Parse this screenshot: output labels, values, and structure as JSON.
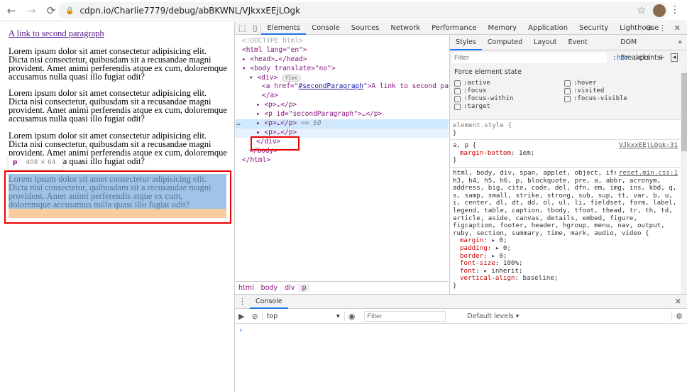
{
  "browser": {
    "url": "cdpn.io/Charlie7779/debug/abBKWNL/VJkxxEEjLOgk",
    "back": "←",
    "forward": "→",
    "reload": "⟳",
    "star": "☆",
    "menu": "⋮"
  },
  "page": {
    "link": "A link to second paragraph",
    "paragraphs": [
      "Lorem ipsum dolor sit amet consectetur adipisicing elit. Dicta nisi consectetur, quibusdam sit a recusandae magni provident. Amet animi perferendis atque ex cum, doloremque accusamus nulla quasi illo fugiat odit?",
      "Lorem ipsum dolor sit amet consectetur adipisicing elit. Dicta nisi consectetur, quibusdam sit a recusandae magni provident. Amet animi perferendis atque ex cum, doloremque accusamus nulla quasi illo fugiat odit?",
      "Lorem ipsum dolor sit amet consectetur adipisicing elit. Dicta nisi consectetur, quibusdam sit a recusandae magni provident. Amet animi perferendis atque ex cum, doloremque accusamus nulla quasi illo fugiat odit?",
      "Lorem ipsum dolor sit amet consectetur adipisicing elit. Dicta nisi consectetur, quibusdam sit a recusandae magni provident. Amet animi perferendis atque ex cum, doloremque accusamus nulla quasi illo fugiat odit?"
    ],
    "tooltip": {
      "tag": "p",
      "size": "408 × 64"
    }
  },
  "devtools": {
    "tabs": [
      "Elements",
      "Console",
      "Sources",
      "Network",
      "Performance",
      "Memory",
      "Application",
      "Security",
      "Lighthouse"
    ],
    "dom": {
      "doctype": "<!DOCTYPE html>",
      "html_open": "<html lang=\"en\">",
      "head": "<head>…</head>",
      "body_open": "<body translate=\"no\">",
      "div_open": "<div>",
      "flex_badge": "flex",
      "a_open1": "<a href=\"",
      "a_href": "#secondParagraph",
      "a_open2": "\">A link to second paragraph",
      "a_close": "</a>",
      "p1": "<p>…</p>",
      "p2": "<p id=\"secondParagraph\">…</p>",
      "p3": "<p>…</p>",
      "p3_suffix": "== $0",
      "p4": "<p>…</p>",
      "div_close": "</div>",
      "body_close": "</body>",
      "html_close": "</html>",
      "ellipsis": "…"
    },
    "breadcrumbs": [
      "html",
      "body",
      "div",
      "p"
    ],
    "styles": {
      "tabs": [
        "Styles",
        "Computed",
        "Layout",
        "Event Listeners",
        "DOM Breakpoints",
        "»"
      ],
      "filter_placeholder": "Filter",
      "hov": ":hov",
      "cls": ".cls",
      "plus": "+",
      "force_title": "Force element state",
      "states": [
        ":active",
        ":hover",
        ":focus",
        ":visited",
        ":focus-within",
        ":focus-visible",
        ":target"
      ],
      "element_style": "element.style {",
      "close": "}",
      "rule1": {
        "selector": "a, p {",
        "source": "VJkxxEEjLOgk:31",
        "props": [
          [
            "margin-bottom",
            "1em"
          ]
        ]
      },
      "rule2": {
        "selector": "html, body, div, span, applet, object, iframe, h1, h2, h3, h4, h5, h6, p, blockquote, pre, a, abbr, acronym, address, big, cite, code, del, dfn, em, img, ins, kbd, q, s, samp, small, strike, strong, sub, sup, tt, var, b, u, i, center, dl, dt, dd, ol, ul, li, fieldset, form, label, legend, table, caption, tbody, tfoot, thead, tr, th, td, article, aside, canvas, details, embed, figure, figcaption, footer, header, hgroup, menu, nav, output, ruby, section, summary, time, mark, audio, video {",
        "source": "reset.min.css:1",
        "props": [
          [
            "margin",
            "▸ 0"
          ],
          [
            "padding",
            "▸ 0"
          ],
          [
            "border",
            "▸ 0"
          ],
          [
            "font-size",
            "100%"
          ],
          [
            "font",
            "▸ inherit"
          ],
          [
            "vertical-align",
            "baseline"
          ]
        ]
      }
    },
    "drawer": {
      "tab": "Console",
      "context": "top",
      "filter_placeholder": "Filter",
      "levels": "Default levels ▾",
      "prompt": "›"
    }
  }
}
